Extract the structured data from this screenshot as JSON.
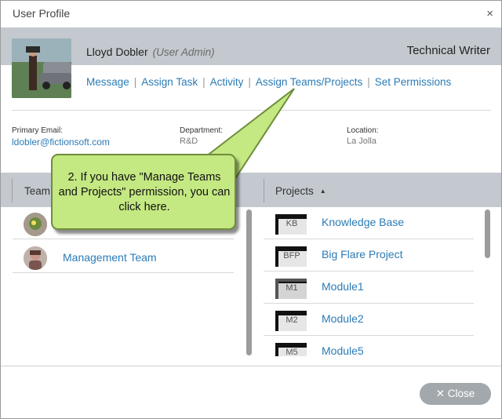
{
  "window": {
    "title": "User Profile",
    "close_icon": "×"
  },
  "profile": {
    "name": "Lloyd Dobler",
    "role": "(User Admin)",
    "job_title": "Technical Writer",
    "actions": [
      "Message",
      "Assign Task",
      "Activity",
      "Assign Teams/Projects",
      "Set Permissions"
    ],
    "separator": "|"
  },
  "details": {
    "email_label": "Primary Email:",
    "email_value": "ldobler@fictionsoft.com",
    "department_label": "Department:",
    "department_value": "R&D",
    "location_label": "Location:",
    "location_value": "La Jolla"
  },
  "teams": {
    "header": "Team",
    "items": [
      {
        "name": ""
      },
      {
        "name": "Management Team"
      }
    ]
  },
  "projects": {
    "header": "Projects",
    "sort_icon": "▲",
    "items": [
      {
        "code": "KB",
        "name": "Knowledge Base"
      },
      {
        "code": "BFP",
        "name": "Big Flare Project"
      },
      {
        "code": "M1",
        "name": "Module1"
      },
      {
        "code": "M2",
        "name": "Module2"
      },
      {
        "code": "M5",
        "name": "Module5"
      }
    ]
  },
  "footer": {
    "close_label": "✕ Close"
  },
  "callout": {
    "text": "2. If you have \"Manage Teams and Projects\" permission, you can click here."
  },
  "colors": {
    "link": "#2b7bb6",
    "band": "#c3c9ce",
    "callout": "#c4e882"
  }
}
